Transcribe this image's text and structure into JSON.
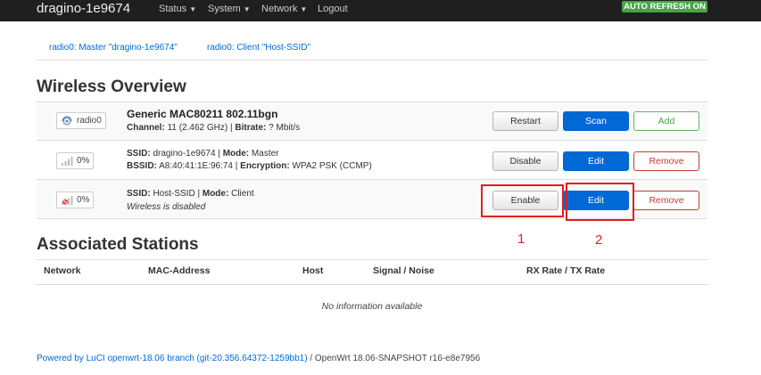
{
  "header": {
    "brand": "dragino-1e9674",
    "menu": [
      "Status",
      "System",
      "Network",
      "Logout"
    ],
    "auto_refresh": "AUTO REFRESH ON"
  },
  "tabs": [
    "radio0: Master \"dragino-1e9674\"",
    "radio0: Client \"Host-SSID\""
  ],
  "overview": {
    "title": "Wireless Overview",
    "device": {
      "badge": "radio0",
      "name": "Generic MAC80211 802.11bgn",
      "channel_label": "Channel:",
      "channel_value": "11 (2.462 GHz)",
      "sep": "|",
      "bitrate_label": "Bitrate:",
      "bitrate_value": "? Mbit/s",
      "buttons": [
        "Restart",
        "Scan",
        "Add"
      ]
    },
    "networks": [
      {
        "badge": "0%",
        "ssid_label": "SSID:",
        "ssid_value": "dragino-1e9674",
        "mode_label": "Mode:",
        "mode_value": "Master",
        "bssid_label": "BSSID:",
        "bssid_value": "A8:40:41:1E:96:74",
        "enc_label": "Encryption:",
        "enc_value": "WPA2 PSK (CCMP)",
        "sep": "|",
        "buttons": [
          "Disable",
          "Edit",
          "Remove"
        ]
      },
      {
        "badge": "0%",
        "ssid_label": "SSID:",
        "ssid_value": "Host-SSID",
        "mode_label": "Mode:",
        "mode_value": "Client",
        "status": "Wireless is disabled",
        "sep": "|",
        "buttons": [
          "Enable",
          "Edit",
          "Remove"
        ]
      }
    ]
  },
  "annotations": [
    "1",
    "2"
  ],
  "stations": {
    "title": "Associated Stations",
    "columns": [
      "Network",
      "MAC-Address",
      "Host",
      "Signal / Noise",
      "RX Rate / TX Rate"
    ],
    "empty": "No information available"
  },
  "footer": {
    "link": "Powered by LuCI openwrt-18.06 branch (git-20.356.64372-1259bb1)",
    "rest": "/ OpenWrt 18.06-SNAPSHOT r16-e8e7956"
  },
  "colors": {
    "navbar": "#1f1f1f",
    "primary": "#0069d6",
    "success": "#46a546",
    "danger": "#c43c35",
    "annotation": "#e02020"
  }
}
